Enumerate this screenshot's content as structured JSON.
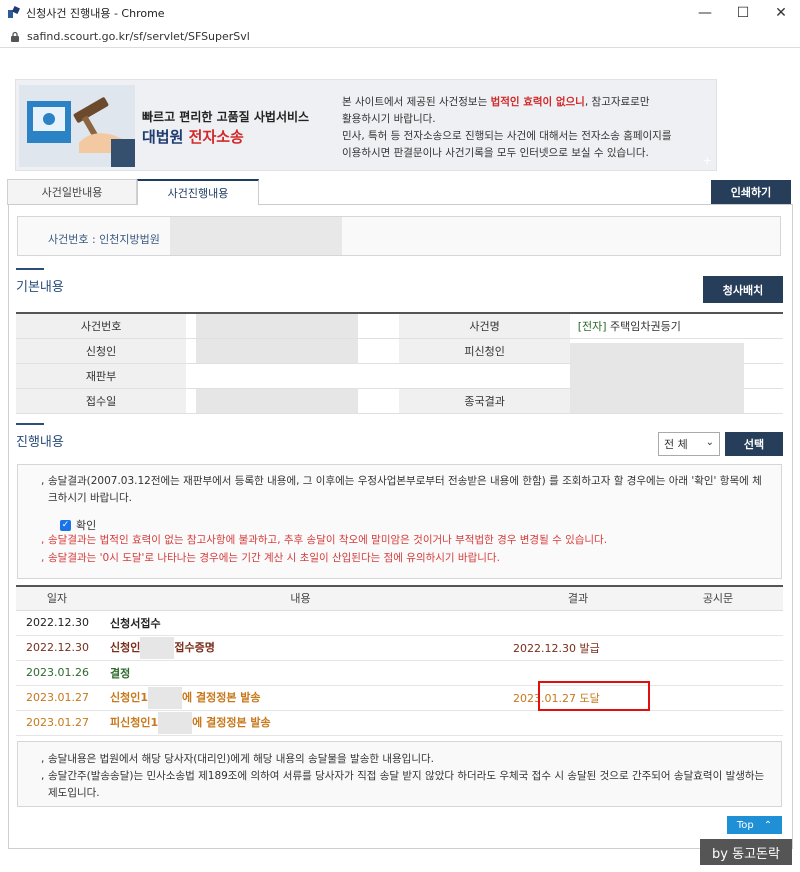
{
  "window": {
    "title": "신청사건 진행내용 - Chrome",
    "url": "safind.scourt.go.kr/sf/servlet/SFSuperSvl"
  },
  "banner": {
    "subtitle": "빠르고 편리한 고품질 사법서비스",
    "brand_a": "대법원",
    "brand_b": "전자소송",
    "notice_1a": "본 사이트에서 제공된 사건정보는 ",
    "notice_1warn": "법적인 효력이 없으니",
    "notice_1b": ", 참고자료로만",
    "notice_2": "활용하시기 바랍니다.",
    "notice_3": "민사, 특허 등 전자소송으로 진행되는 사건에 대해서는 전자소송 홈페이지를",
    "notice_4": "이용하시면 판결문이나 사건기록을 모두 인터넷으로 보실 수 있습니다.",
    "plus": "+"
  },
  "tabs": {
    "general": "사건일반내용",
    "progress": "사건진행내용",
    "print": "인쇄하기"
  },
  "case_header": {
    "label": "사건번호 : 인천지방법원 "
  },
  "basic": {
    "heading": "기본내용",
    "dispatch_button": "청사배치",
    "rows": [
      {
        "h1": "사건번호",
        "v1": "",
        "h2": "사건명",
        "v2_tag": "[전자]",
        "v2": " 주택임차권등기"
      },
      {
        "h1": "신청인",
        "v1": "",
        "h2": "피신청인",
        "v2_tag": "",
        "v2": ""
      },
      {
        "h1": "재판부",
        "v1": "",
        "h2": "",
        "v2_tag": "",
        "v2": ""
      },
      {
        "h1": "접수일",
        "v1": "",
        "h2": "종국결과",
        "v2_tag": "",
        "v2": ""
      }
    ]
  },
  "progress": {
    "heading": "진행내용",
    "filter_value": "전 체",
    "select_button": "선택",
    "notice_1": "송달결과(2007.03.12전에는 재판부에서 등록한 내용에, 그 이후에는 우정사업본부로부터 전송받은 내용에 한함) 를 조회하고자 할 경우에는 아래 '확인' 항목에 체크하시기 바랍니다.",
    "check_label": "확인",
    "notice_2": "송달결과는 법적인 효력이 없는 참고사항에 불과하고, 추후 송달이 착오에 말미암은 것이거나 부적법한 경우 변경될 수 있습니다.",
    "notice_3": "송달결과는 '0시 도달'로 나타나는 경우에는 기간 계산 시 초일이 산입된다는 점에 유의하시기 바랍니다.",
    "columns": [
      "일자",
      "내용",
      "결과",
      "공시문"
    ],
    "rows": [
      {
        "date": "2022.12.30",
        "content_a": "신청서접수",
        "content_b": "",
        "result": "",
        "color": "c-dark"
      },
      {
        "date": "2022.12.30",
        "content_a": "신청인",
        "content_b": "접수증명",
        "result": "2022.12.30 발급",
        "color": "c-maroon"
      },
      {
        "date": "2023.01.26",
        "content_a": "결정",
        "content_b": "",
        "result": "",
        "color": "c-green"
      },
      {
        "date": "2023.01.27",
        "content_a": "신청인1",
        "content_b": "에 결정정본 발송",
        "result": "2023.01.27 도달",
        "color": "c-orange"
      },
      {
        "date": "2023.01.27",
        "content_a": "피신청인1",
        "content_b": "에 결정정본 발송",
        "result": "",
        "color": "c-orange"
      }
    ]
  },
  "footer": {
    "note_1": "송달내용은 법원에서 해당 당사자(대리인)에게 해당 내용의 송달물을 발송한 내용입니다.",
    "note_2": "송달간주(발송송달)는 민사소송법 제189조에 의하여 서류를 당사자가 직접 송달 받지 않았다 하더라도 우체국 접수 시 송달된 것으로 간주되어 송달효력이 발생하는 제도입니다.",
    "top_button": "Top",
    "watermark": "by 동고돈락"
  }
}
